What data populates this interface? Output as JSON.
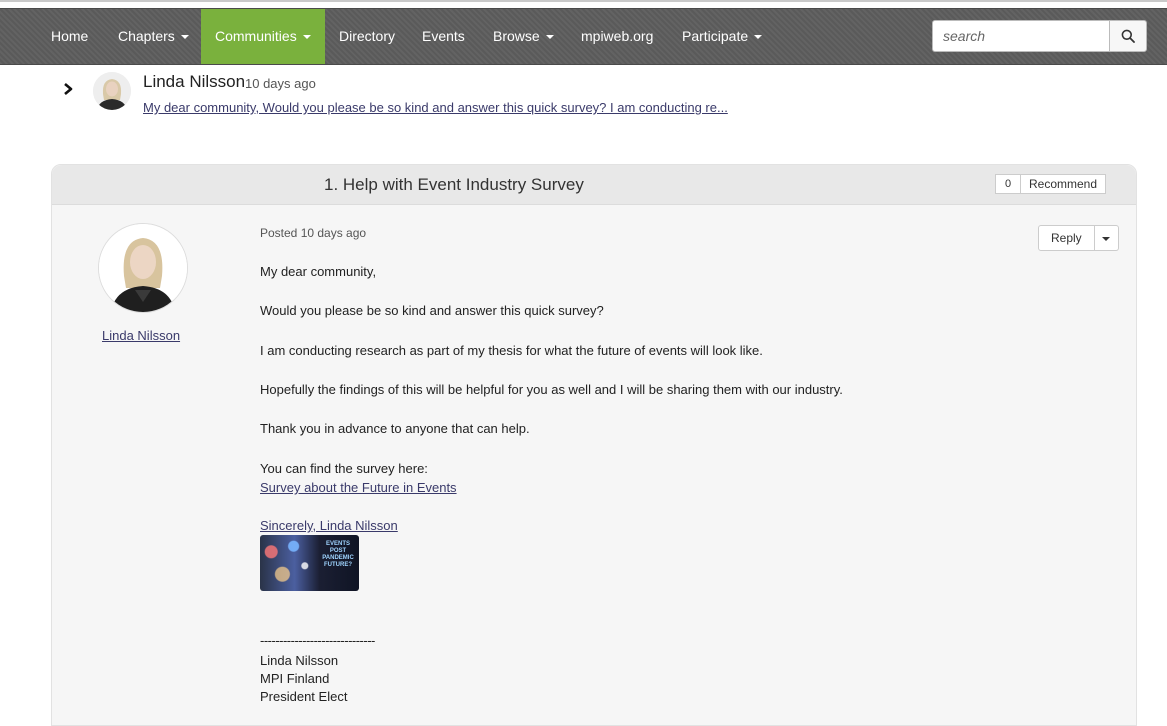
{
  "nav": {
    "items": [
      {
        "label": "Home",
        "dropdown": false
      },
      {
        "label": "Chapters",
        "dropdown": true
      },
      {
        "label": "Communities",
        "dropdown": true
      },
      {
        "label": "Directory",
        "dropdown": false
      },
      {
        "label": "Events",
        "dropdown": false
      },
      {
        "label": "Browse",
        "dropdown": true
      },
      {
        "label": "mpiweb.org",
        "dropdown": false
      },
      {
        "label": "Participate",
        "dropdown": true
      }
    ],
    "active": "Communities",
    "active_color": "#7ab13d",
    "bar_color": "#5d5d5d",
    "search_placeholder": "search"
  },
  "thread": {
    "author": "Linda Nilsson",
    "time": "10 days ago",
    "snippet": "My dear community,  Would you please be so kind and answer this quick survey?  I am conducting re..."
  },
  "post": {
    "title": "1.  Help with Event Industry Survey",
    "recommend_count": "0",
    "recommend_label": "Recommend",
    "author": "Linda Nilsson",
    "posted": "Posted 10 days ago",
    "reply_label": "Reply",
    "paragraphs": [
      "My dear community,",
      "Would you please be so kind and answer this quick survey?",
      "I am conducting research as part of my thesis for what the future of events will look like.",
      "Hopefully the findings of this will be helpful for you as well and I will be sharing them with our industry.",
      "Thank you in advance to anyone that can help.",
      "You can find the survey here:"
    ],
    "survey_link": "Survey about the Future in Events",
    "sincerely": "Sincerely, Linda Nilsson",
    "image_text": "EVENTS POST PANDEMIC FUTURE?",
    "signature": {
      "divider": "------------------------------",
      "name": "Linda Nilsson",
      "org": "MPI Finland",
      "role": "President Elect"
    }
  }
}
